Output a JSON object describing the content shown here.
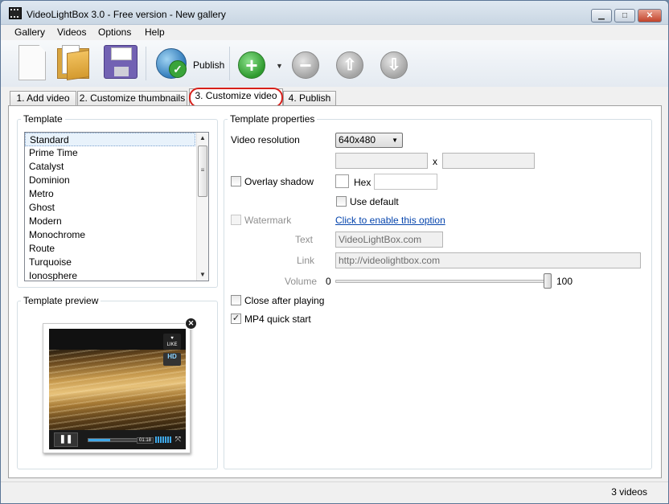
{
  "window": {
    "title": "VideoLightBox 3.0 - Free version - New gallery"
  },
  "menu": [
    "Gallery",
    "Videos",
    "Options",
    "Help"
  ],
  "toolbar": {
    "publish_label": "Publish"
  },
  "tabs": [
    "1. Add video",
    "2. Customize thumbnails",
    "3. Customize video",
    "4. Publish"
  ],
  "template": {
    "group_title": "Template",
    "items": [
      "Standard",
      "Prime Time",
      "Catalyst",
      "Dominion",
      "Metro",
      "Ghost",
      "Modern",
      "Monochrome",
      "Route",
      "Turquoise",
      "Ionosphere"
    ],
    "selected": "Standard"
  },
  "preview": {
    "group_title": "Template preview",
    "time": "01:18",
    "progress": 0.35,
    "like": "LIKE",
    "hd": "HD"
  },
  "props": {
    "group_title": "Template properties",
    "resolution_label": "Video resolution",
    "resolution_value": "640x480",
    "times_sign": "x",
    "overlay_shadow_label": "Overlay shadow",
    "hex_label": "Hex",
    "use_default_label": "Use default",
    "watermark_label": "Watermark",
    "watermark_link": "Click to enable this option",
    "text_label": "Text",
    "text_value": "VideoLightBox.com",
    "link_label": "Link",
    "link_value": "http://videolightbox.com",
    "volume_label": "Volume",
    "volume_min": "0",
    "volume_max": "100",
    "volume_value": 100,
    "close_after_label": "Close after playing",
    "mp4_label": "MP4 quick start",
    "mp4_checked": true
  },
  "status": {
    "text": "3 videos"
  }
}
